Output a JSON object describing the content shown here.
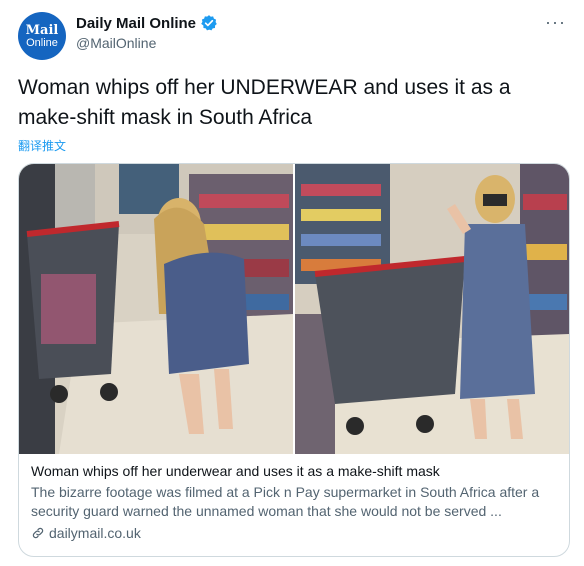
{
  "author": {
    "avatar_line1": "Mail",
    "avatar_line2": "Online",
    "display_name": "Daily Mail Online",
    "handle": "@MailOnline"
  },
  "tweet": {
    "text": "Woman whips off her UNDERWEAR and uses it as a make-shift mask in South Africa",
    "translate_label": "翻译推文"
  },
  "card": {
    "title": "Woman whips off her underwear and uses it as a make-shift mask",
    "description": "The bizarre footage was filmed at a Pick n Pay supermarket in South Africa after a security guard warned the unnamed woman that she would not be served ...",
    "domain": "dailymail.co.uk"
  },
  "icons": {
    "verified": "verified-badge-icon",
    "more": "more-options-icon",
    "link": "link-icon"
  },
  "colors": {
    "accent": "#1d9bf0",
    "avatar_bg": "#1565c0",
    "secondary_text": "#536471",
    "border": "#cfd9de"
  }
}
